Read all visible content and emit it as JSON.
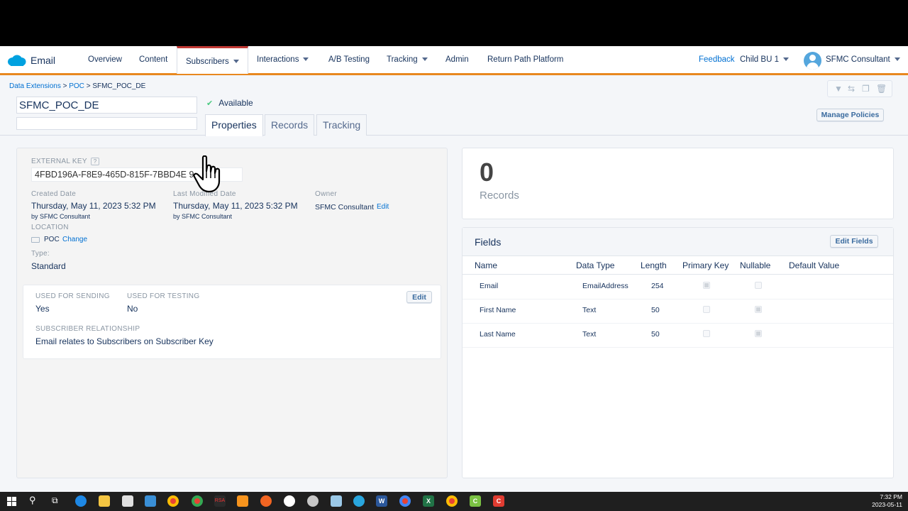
{
  "nav": {
    "app_name": "Email",
    "items": [
      "Overview",
      "Content",
      "Subscribers",
      "Interactions",
      "A/B Testing",
      "Tracking",
      "Admin",
      "Return Path Platform"
    ],
    "feedback": "Feedback",
    "business_unit": "Child BU 1",
    "user": "SFMC Consultant"
  },
  "header": {
    "breadcrumb": [
      "Data Extensions",
      "POC",
      "SFMC_POC_DE"
    ],
    "breadcrumb_sep": ">",
    "name_value": "SFMC_POC_DE",
    "status": "Available",
    "tabs": [
      "Properties",
      "Records",
      "Tracking"
    ],
    "manage_policies": "Manage Policies"
  },
  "properties": {
    "external_key_label": "EXTERNAL KEY",
    "external_key_value": "4FBD196A-F8E9-465D-815F-7BBD4E      9",
    "created_label": "Created Date",
    "created_value": "Thursday, May 11, 2023 5:32 PM",
    "created_by": "by SFMC Consultant",
    "modified_label": "Last Modified Date",
    "modified_value": "Thursday, May 11, 2023 5:32 PM",
    "modified_by": "by SFMC Consultant",
    "owner_label": "Owner",
    "owner_value": "SFMC Consultant",
    "owner_edit": "Edit",
    "location_label": "LOCATION",
    "location_value": "POC",
    "location_change": "Change",
    "type_label": "Type:",
    "type_value": "Standard"
  },
  "sending": {
    "used_for_sending_label": "USED FOR SENDING",
    "used_for_sending_value": "Yes",
    "used_for_testing_label": "USED FOR TESTING",
    "used_for_testing_value": "No",
    "edit": "Edit",
    "relationship_label": "SUBSCRIBER RELATIONSHIP",
    "relationship_value": "Email relates to Subscribers on Subscriber Key"
  },
  "records": {
    "count": "0",
    "label": "Records"
  },
  "fields": {
    "title": "Fields",
    "edit_fields": "Edit Fields",
    "columns": [
      "Name",
      "Data Type",
      "Length",
      "Primary Key",
      "Nullable",
      "Default Value"
    ],
    "rows": [
      {
        "name": "Email",
        "type": "EmailAddress",
        "length": "254",
        "primary_key": true,
        "nullable": false
      },
      {
        "name": "First Name",
        "type": "Text",
        "length": "50",
        "primary_key": false,
        "nullable": true
      },
      {
        "name": "Last Name",
        "type": "Text",
        "length": "50",
        "primary_key": false,
        "nullable": true
      }
    ]
  },
  "taskbar": {
    "time": "7:32 PM",
    "date": "2023-05-11"
  },
  "colors": {
    "nav_accent": "#e8881f",
    "active_tab_accent": "#c23934",
    "link": "#0070d2",
    "text": "#16325c",
    "status_check": "#4bca81"
  }
}
